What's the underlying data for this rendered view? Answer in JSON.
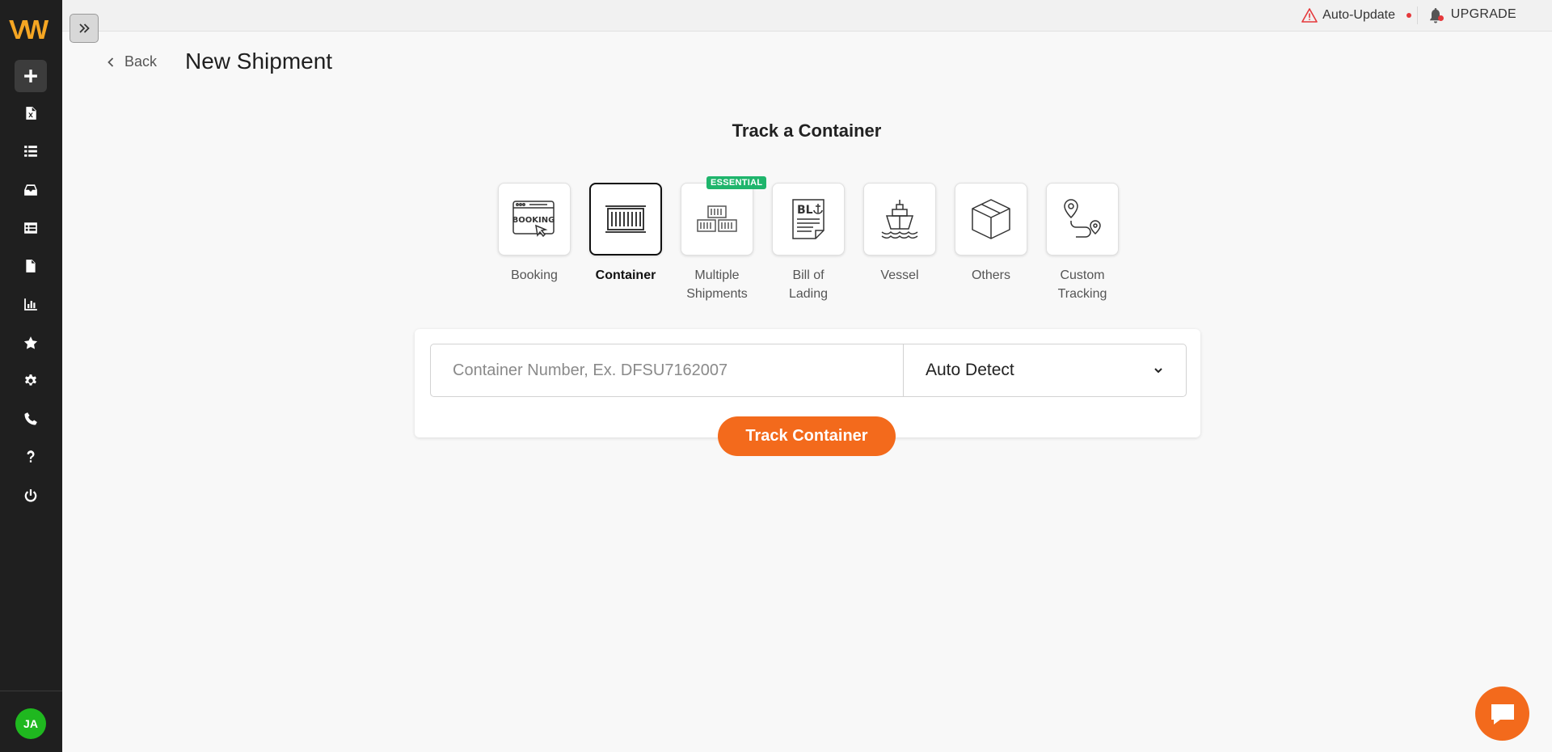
{
  "app": {
    "logo_text": "VW"
  },
  "topbar": {
    "auto_update_label": "Auto-Update",
    "upgrade_label": "UPGRADE"
  },
  "header": {
    "back_label": "Back",
    "page_title": "New Shipment"
  },
  "main": {
    "section_title": "Track a Container",
    "essential_badge": "ESSENTIAL",
    "tracking_types": [
      {
        "label": "Booking",
        "icon": "booking-icon",
        "selected": false
      },
      {
        "label": "Container",
        "icon": "container-icon",
        "selected": true
      },
      {
        "label": "Multiple Shipments",
        "icon": "multiple-shipments-icon",
        "selected": false
      },
      {
        "label": "Bill of Lading",
        "icon": "bill-of-lading-icon",
        "selected": false
      },
      {
        "label": "Vessel",
        "icon": "vessel-icon",
        "selected": false
      },
      {
        "label": "Others",
        "icon": "box-icon",
        "selected": false
      },
      {
        "label": "Custom Tracking",
        "icon": "route-icon",
        "selected": false
      }
    ],
    "search": {
      "placeholder": "Container Number, Ex. DFSU7162007",
      "value": "",
      "carrier_select": "Auto Detect"
    },
    "track_button": "Track Container"
  },
  "sidebar": {
    "items": [
      {
        "icon": "plus-icon",
        "active": true
      },
      {
        "icon": "excel-file-icon",
        "active": false
      },
      {
        "icon": "list-icon",
        "active": false
      },
      {
        "icon": "inbox-icon",
        "active": false
      },
      {
        "icon": "table-icon",
        "active": false
      },
      {
        "icon": "document-icon",
        "active": false
      },
      {
        "icon": "bar-chart-icon",
        "active": false
      },
      {
        "icon": "star-icon",
        "active": false
      },
      {
        "icon": "gear-icon",
        "active": false
      },
      {
        "icon": "phone-icon",
        "active": false
      },
      {
        "icon": "question-icon",
        "active": false
      },
      {
        "icon": "power-icon",
        "active": false
      }
    ],
    "user_initials": "JA"
  },
  "colors": {
    "accent": "#f36a1c",
    "sidebar_bg": "#1f1f1f",
    "badge_green": "#1fb56c",
    "avatar_green": "#1fb81f"
  }
}
